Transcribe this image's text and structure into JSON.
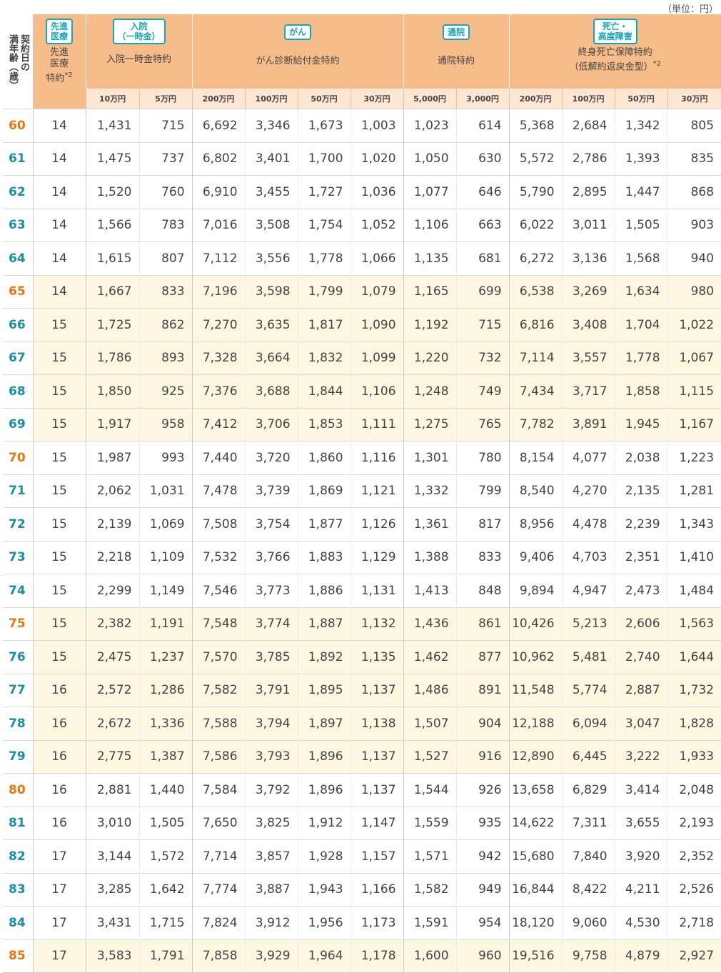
{
  "unit_label": "（単位：円）",
  "header": {
    "age_label_line1": "契約日の",
    "age_label_line2": "満年齢（歳）",
    "groups": [
      {
        "badge": "先進\n医療",
        "name": "先進\n医療\n特約",
        "note": "*2"
      },
      {
        "badge": "入院\n（一時金）",
        "name": "入院一時金特約",
        "note": ""
      },
      {
        "badge": "がん",
        "name": "がん診断給付金特約",
        "note": ""
      },
      {
        "badge": "通院",
        "name": "通院特約",
        "note": ""
      },
      {
        "badge": "死亡・\n高度障害",
        "name": "終身死亡保障特約\n（低解約返戻金型）",
        "note": "*2"
      }
    ],
    "sub_columns": [
      "10万円",
      "5万円",
      "200万円",
      "100万円",
      "50万円",
      "30万円",
      "5,000円",
      "3,000円",
      "200万円",
      "100万円",
      "50万円",
      "30万円"
    ]
  },
  "colors": {
    "header_bg": "#f6bd8a",
    "subheader_bg": "#fde7d3",
    "highlight_row_bg": "#fdf6e1",
    "badge_teal": "#16a6b6",
    "age_orange": "#e8760e",
    "age_teal": "#1a8fa3"
  },
  "rows": [
    {
      "age": "60",
      "color": "orange",
      "hl": false,
      "cells": [
        "14",
        "1,431",
        "715",
        "6,692",
        "3,346",
        "1,673",
        "1,003",
        "1,023",
        "614",
        "5,368",
        "2,684",
        "1,342",
        "805"
      ]
    },
    {
      "age": "61",
      "color": "teal",
      "hl": false,
      "cells": [
        "14",
        "1,475",
        "737",
        "6,802",
        "3,401",
        "1,700",
        "1,020",
        "1,050",
        "630",
        "5,572",
        "2,786",
        "1,393",
        "835"
      ]
    },
    {
      "age": "62",
      "color": "teal",
      "hl": false,
      "cells": [
        "14",
        "1,520",
        "760",
        "6,910",
        "3,455",
        "1,727",
        "1,036",
        "1,077",
        "646",
        "5,790",
        "2,895",
        "1,447",
        "868"
      ]
    },
    {
      "age": "63",
      "color": "teal",
      "hl": false,
      "cells": [
        "14",
        "1,566",
        "783",
        "7,016",
        "3,508",
        "1,754",
        "1,052",
        "1,106",
        "663",
        "6,022",
        "3,011",
        "1,505",
        "903"
      ]
    },
    {
      "age": "64",
      "color": "teal",
      "hl": false,
      "cells": [
        "14",
        "1,615",
        "807",
        "7,112",
        "3,556",
        "1,778",
        "1,066",
        "1,135",
        "681",
        "6,272",
        "3,136",
        "1,568",
        "940"
      ]
    },
    {
      "age": "65",
      "color": "orange",
      "hl": true,
      "cells": [
        "14",
        "1,667",
        "833",
        "7,196",
        "3,598",
        "1,799",
        "1,079",
        "1,165",
        "699",
        "6,538",
        "3,269",
        "1,634",
        "980"
      ]
    },
    {
      "age": "66",
      "color": "teal",
      "hl": true,
      "cells": [
        "15",
        "1,725",
        "862",
        "7,270",
        "3,635",
        "1,817",
        "1,090",
        "1,192",
        "715",
        "6,816",
        "3,408",
        "1,704",
        "1,022"
      ]
    },
    {
      "age": "67",
      "color": "teal",
      "hl": true,
      "cells": [
        "15",
        "1,786",
        "893",
        "7,328",
        "3,664",
        "1,832",
        "1,099",
        "1,220",
        "732",
        "7,114",
        "3,557",
        "1,778",
        "1,067"
      ]
    },
    {
      "age": "68",
      "color": "teal",
      "hl": true,
      "cells": [
        "15",
        "1,850",
        "925",
        "7,376",
        "3,688",
        "1,844",
        "1,106",
        "1,248",
        "749",
        "7,434",
        "3,717",
        "1,858",
        "1,115"
      ]
    },
    {
      "age": "69",
      "color": "teal",
      "hl": true,
      "cells": [
        "15",
        "1,917",
        "958",
        "7,412",
        "3,706",
        "1,853",
        "1,111",
        "1,275",
        "765",
        "7,782",
        "3,891",
        "1,945",
        "1,167"
      ]
    },
    {
      "age": "70",
      "color": "orange",
      "hl": false,
      "cells": [
        "15",
        "1,987",
        "993",
        "7,440",
        "3,720",
        "1,860",
        "1,116",
        "1,301",
        "780",
        "8,154",
        "4,077",
        "2,038",
        "1,223"
      ]
    },
    {
      "age": "71",
      "color": "teal",
      "hl": false,
      "cells": [
        "15",
        "2,062",
        "1,031",
        "7,478",
        "3,739",
        "1,869",
        "1,121",
        "1,332",
        "799",
        "8,540",
        "4,270",
        "2,135",
        "1,281"
      ]
    },
    {
      "age": "72",
      "color": "teal",
      "hl": false,
      "cells": [
        "15",
        "2,139",
        "1,069",
        "7,508",
        "3,754",
        "1,877",
        "1,126",
        "1,361",
        "817",
        "8,956",
        "4,478",
        "2,239",
        "1,343"
      ]
    },
    {
      "age": "73",
      "color": "teal",
      "hl": false,
      "cells": [
        "15",
        "2,218",
        "1,109",
        "7,532",
        "3,766",
        "1,883",
        "1,129",
        "1,388",
        "833",
        "9,406",
        "4,703",
        "2,351",
        "1,410"
      ]
    },
    {
      "age": "74",
      "color": "teal",
      "hl": false,
      "cells": [
        "15",
        "2,299",
        "1,149",
        "7,546",
        "3,773",
        "1,886",
        "1,131",
        "1,413",
        "848",
        "9,894",
        "4,947",
        "2,473",
        "1,484"
      ]
    },
    {
      "age": "75",
      "color": "orange",
      "hl": true,
      "cells": [
        "15",
        "2,382",
        "1,191",
        "7,548",
        "3,774",
        "1,887",
        "1,132",
        "1,436",
        "861",
        "10,426",
        "5,213",
        "2,606",
        "1,563"
      ]
    },
    {
      "age": "76",
      "color": "teal",
      "hl": true,
      "cells": [
        "15",
        "2,475",
        "1,237",
        "7,570",
        "3,785",
        "1,892",
        "1,135",
        "1,462",
        "877",
        "10,962",
        "5,481",
        "2,740",
        "1,644"
      ]
    },
    {
      "age": "77",
      "color": "teal",
      "hl": true,
      "cells": [
        "16",
        "2,572",
        "1,286",
        "7,582",
        "3,791",
        "1,895",
        "1,137",
        "1,486",
        "891",
        "11,548",
        "5,774",
        "2,887",
        "1,732"
      ]
    },
    {
      "age": "78",
      "color": "teal",
      "hl": true,
      "cells": [
        "16",
        "2,672",
        "1,336",
        "7,588",
        "3,794",
        "1,897",
        "1,138",
        "1,507",
        "904",
        "12,188",
        "6,094",
        "3,047",
        "1,828"
      ]
    },
    {
      "age": "79",
      "color": "teal",
      "hl": true,
      "cells": [
        "16",
        "2,775",
        "1,387",
        "7,586",
        "3,793",
        "1,896",
        "1,137",
        "1,527",
        "916",
        "12,890",
        "6,445",
        "3,222",
        "1,933"
      ]
    },
    {
      "age": "80",
      "color": "orange",
      "hl": false,
      "cells": [
        "16",
        "2,881",
        "1,440",
        "7,584",
        "3,792",
        "1,896",
        "1,137",
        "1,544",
        "926",
        "13,658",
        "6,829",
        "3,414",
        "2,048"
      ]
    },
    {
      "age": "81",
      "color": "teal",
      "hl": false,
      "cells": [
        "16",
        "3,010",
        "1,505",
        "7,650",
        "3,825",
        "1,912",
        "1,147",
        "1,559",
        "935",
        "14,622",
        "7,311",
        "3,655",
        "2,193"
      ]
    },
    {
      "age": "82",
      "color": "teal",
      "hl": false,
      "cells": [
        "17",
        "3,144",
        "1,572",
        "7,714",
        "3,857",
        "1,928",
        "1,157",
        "1,571",
        "942",
        "15,680",
        "7,840",
        "3,920",
        "2,352"
      ]
    },
    {
      "age": "83",
      "color": "teal",
      "hl": false,
      "cells": [
        "17",
        "3,285",
        "1,642",
        "7,774",
        "3,887",
        "1,943",
        "1,166",
        "1,582",
        "949",
        "16,844",
        "8,422",
        "4,211",
        "2,526"
      ]
    },
    {
      "age": "84",
      "color": "teal",
      "hl": false,
      "cells": [
        "17",
        "3,431",
        "1,715",
        "7,824",
        "3,912",
        "1,956",
        "1,173",
        "1,591",
        "954",
        "18,120",
        "9,060",
        "4,530",
        "2,718"
      ]
    },
    {
      "age": "85",
      "color": "orange",
      "hl": true,
      "cells": [
        "17",
        "3,583",
        "1,791",
        "7,858",
        "3,929",
        "1,964",
        "1,178",
        "1,600",
        "960",
        "19,516",
        "9,758",
        "4,879",
        "2,927"
      ]
    }
  ]
}
